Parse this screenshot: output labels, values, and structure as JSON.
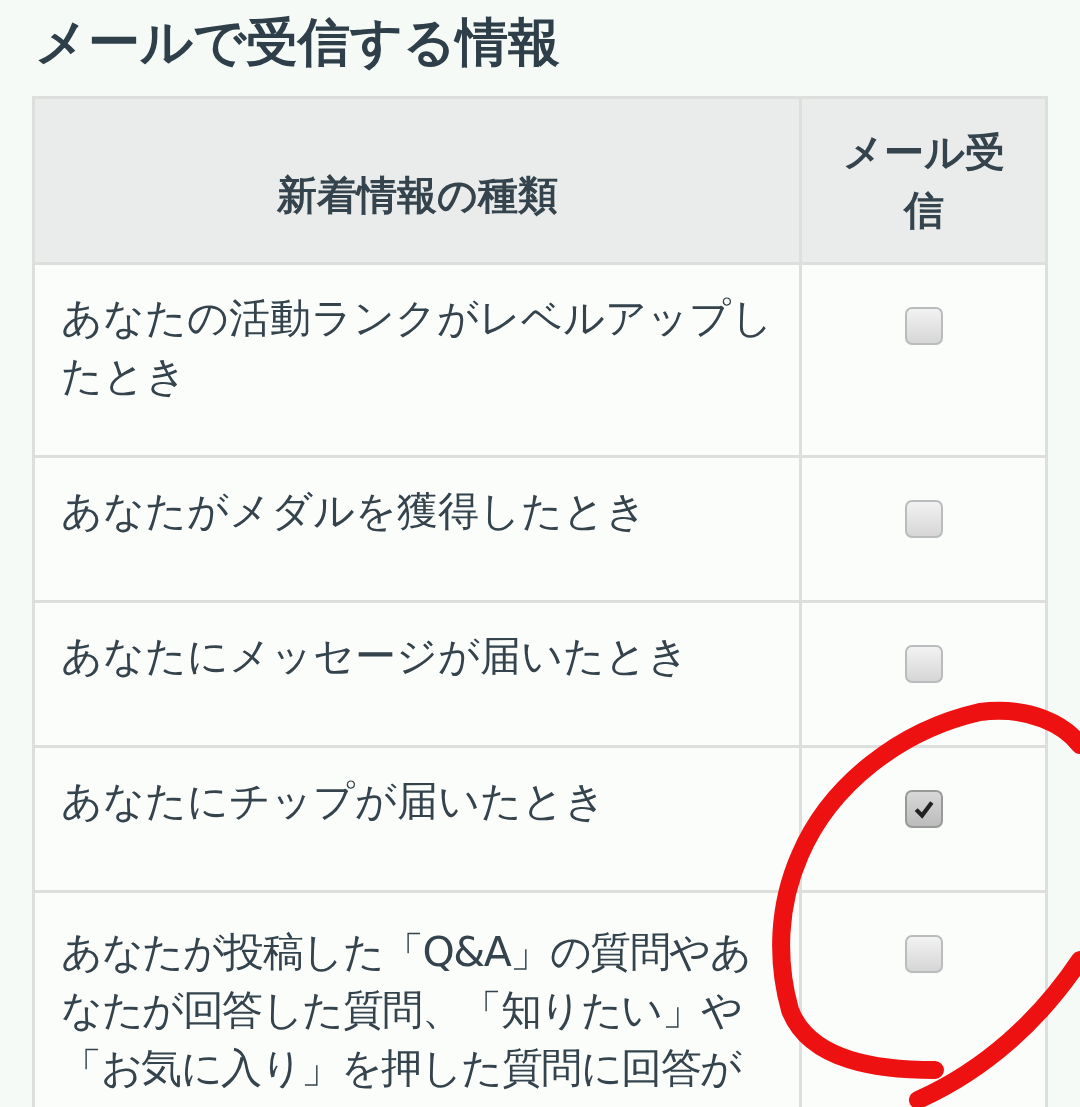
{
  "title": "メールで受信する情報",
  "table": {
    "columns": [
      "新着情報の種類",
      "メール受信"
    ],
    "rows": [
      {
        "label": "あなたの活動ランクがレベルアップしたとき",
        "checked": false
      },
      {
        "label": "あなたがメダルを獲得したとき",
        "checked": false
      },
      {
        "label": "あなたにメッセージが届いたとき",
        "checked": false
      },
      {
        "label": "あなたにチップが届いたとき",
        "checked": true
      },
      {
        "label": "あなたが投稿した「Q&A」の質問やあなたが回答した質問、「知りたい」や「お気に入り」を押した質問に回答が",
        "checked": false
      }
    ]
  }
}
